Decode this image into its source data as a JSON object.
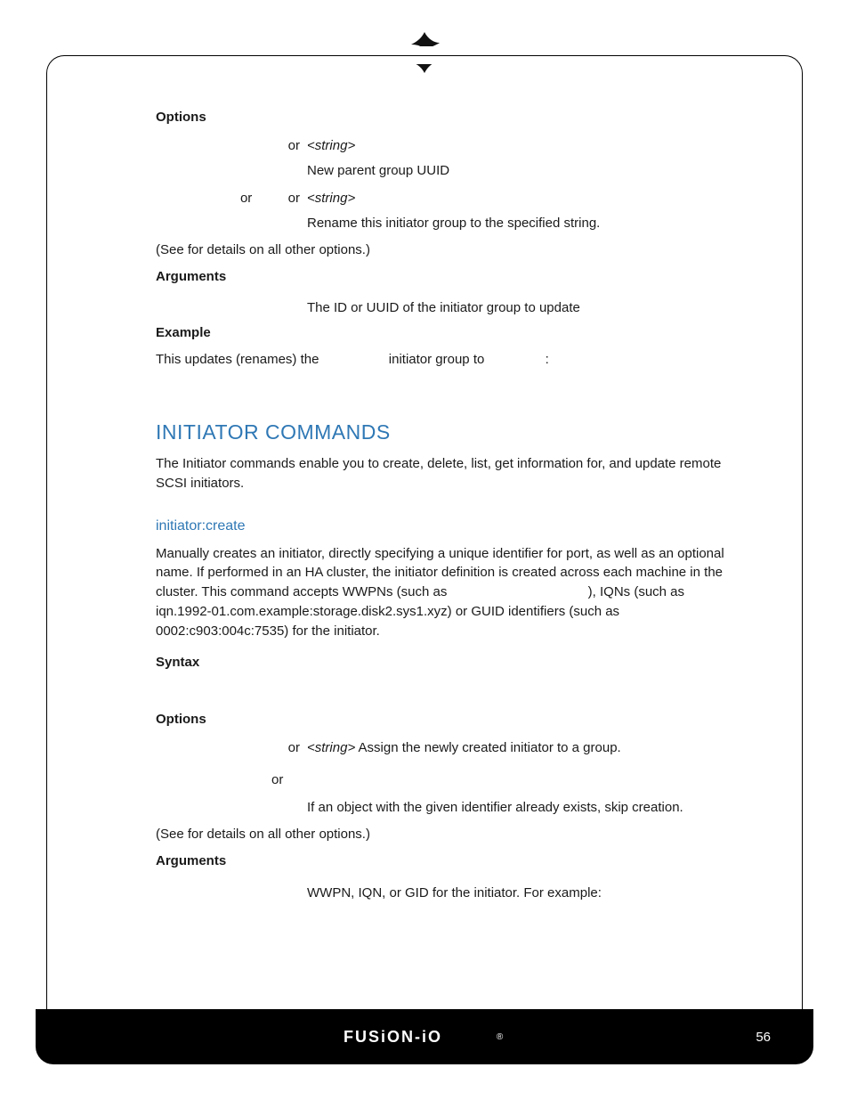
{
  "header": {
    "top_icon": "leaf-swirl-icon"
  },
  "s1": {
    "options_h": "Options",
    "opt1_or": "or",
    "opt1_arg": "<string>",
    "opt1_desc": "New parent group UUID",
    "opt2_or1": "or",
    "opt2_or2": "or",
    "opt2_arg": "<string>",
    "opt2_desc": "Rename this initiator group to the specified string.",
    "see_pre": "(See ",
    "see_post": " for details on all other options.)",
    "arguments_h": "Arguments",
    "arg1_desc": "The ID or UUID of the initiator group to update",
    "example_h": "Example",
    "ex_p1": "This updates (renames) the ",
    "ex_p2": " initiator group to ",
    "ex_p3": ":"
  },
  "s2": {
    "title": "INITIATOR COMMANDS",
    "intro": "The Initiator commands enable you to create, delete, list, get information for, and update remote SCSI initiators.",
    "sub": "initiator:create",
    "desc_a": "Manually creates an initiator, directly specifying a unique identifier for port, as well as an optional name. If performed in an HA cluster, the initiator definition is created across each machine in the cluster. This command accepts WWPNs (such as ",
    "desc_b": "), IQNs (such as iqn.1992-01.com.example:storage.disk2.sys1.xyz) or GUID identifiers (such as 0002:c903:004c:7535) for the initiator.",
    "syntax_h": "Syntax",
    "options_h": "Options",
    "opt1_or": "or",
    "opt1_arg": "<string>",
    "opt1_rest": " Assign the newly created initiator to a group.",
    "opt2_or": "or",
    "opt2_desc": "If an object with the given identifier already exists, skip creation.",
    "see_pre": "(See ",
    "see_post": " for details on all other options.)",
    "arguments_h": "Arguments",
    "arg1_desc": "WWPN, IQN, or GID for the initiator. For example:"
  },
  "footer": {
    "brand": "FUSION-iO",
    "reg": "®",
    "page": "56"
  }
}
